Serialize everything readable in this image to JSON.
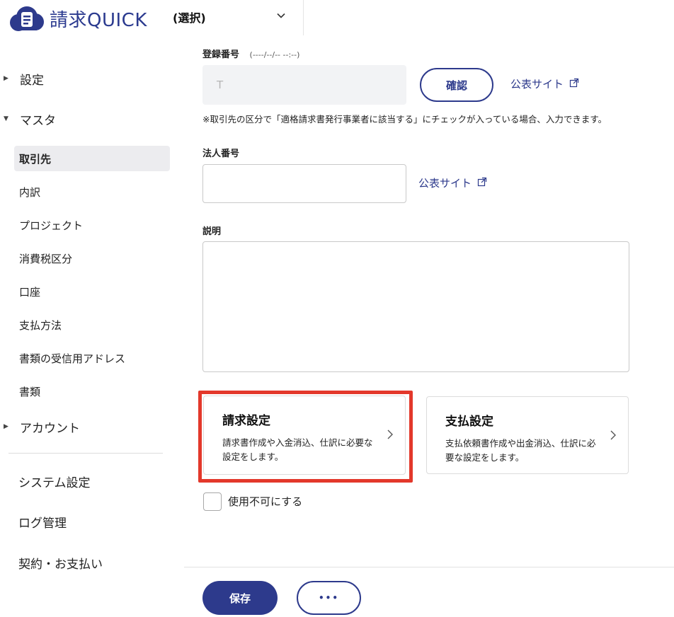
{
  "header": {
    "app_name": "請求QUICK",
    "company_selector": "(選択)"
  },
  "sidebar": {
    "sections": [
      {
        "label": "設定",
        "expanded": false
      },
      {
        "label": "マスタ",
        "expanded": true
      },
      {
        "label": "アカウント",
        "expanded": false
      }
    ],
    "master_items": [
      "取引先",
      "内訳",
      "プロジェクト",
      "消費税区分",
      "口座",
      "支払方法",
      "書類の受信用アドレス",
      "書類"
    ],
    "active_item": "取引先",
    "bottom_items": [
      "システム設定",
      "ログ管理",
      "契約・お支払い"
    ]
  },
  "form": {
    "registration": {
      "label": "登録番号",
      "timestamp": "(----/--/-- --:--)",
      "placeholder": "T",
      "confirm_button": "確認",
      "public_site_link": "公表サイト",
      "note": "※取引先の区分で「適格請求書発行事業者に該当する」にチェックが入っている場合、入力できます。"
    },
    "corporate_number": {
      "label": "法人番号",
      "value": "",
      "public_site_link": "公表サイト"
    },
    "description": {
      "label": "説明",
      "value": ""
    }
  },
  "cards": {
    "billing": {
      "title": "請求設定",
      "description": "請求書作成や入金消込、仕訳に必要な設定をします。",
      "highlighted": true
    },
    "payment": {
      "title": "支払設定",
      "description": "支払依頼書作成や出金消込、仕訳に必要な設定をします。"
    }
  },
  "disable_checkbox": {
    "label": "使用不可にする",
    "checked": false
  },
  "footer": {
    "save_button": "保存",
    "more_button": "•••"
  },
  "colors": {
    "brand": "#2d3a8c",
    "highlight": "#e3382b"
  }
}
